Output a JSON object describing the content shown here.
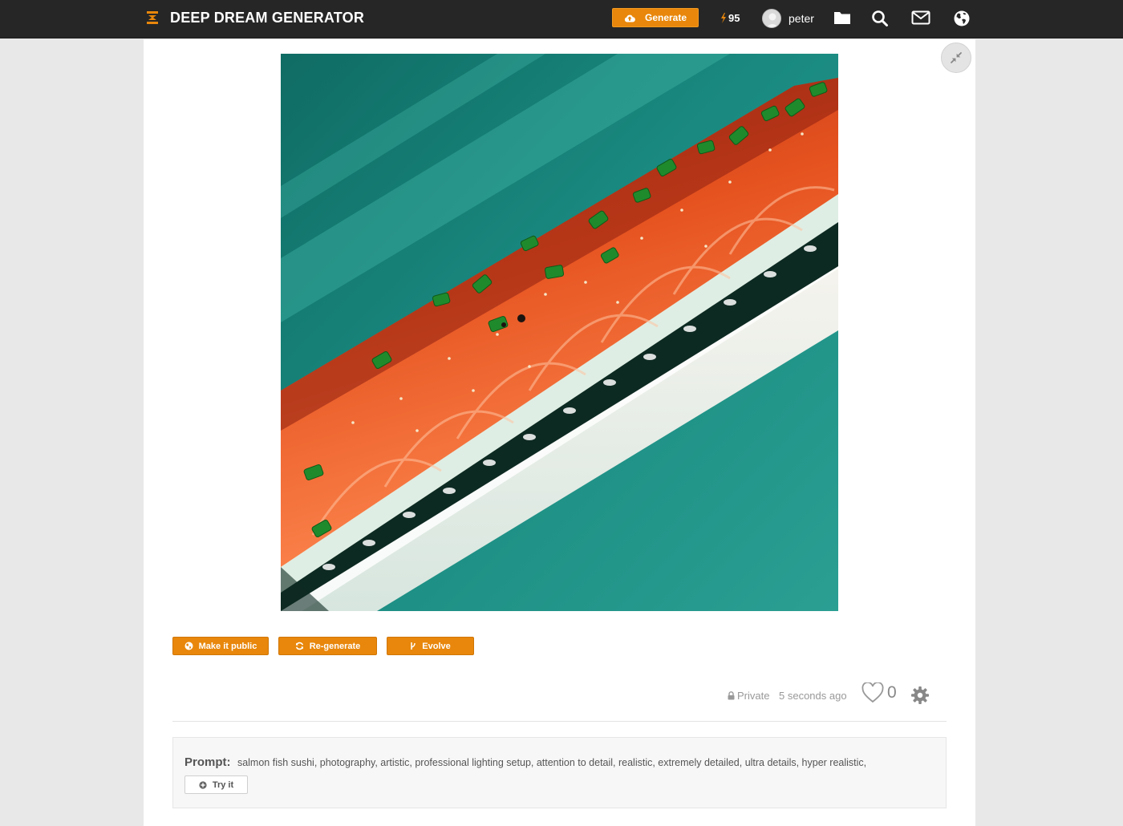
{
  "header": {
    "brand": "DEEP DREAM GENERATOR",
    "generate_label": "Generate",
    "energy": "95",
    "username": "peter",
    "icons": [
      "folder-icon",
      "search-icon",
      "mail-icon",
      "globe-icon"
    ]
  },
  "image": {
    "subject": "salmon fish sushi"
  },
  "actions": {
    "make_public": "Make it public",
    "regenerate": "Re-generate",
    "evolve": "Evolve"
  },
  "meta": {
    "visibility": "Private",
    "time": "5 seconds ago",
    "likes": "0"
  },
  "prompt": {
    "label": "Prompt:",
    "text": "salmon fish sushi, photography, artistic, professional lighting setup, attention to detail, realistic, extremely detailed, ultra details, hyper realistic,",
    "try_label": "Try it"
  },
  "colors": {
    "accent": "#e8870b",
    "navbar": "#262626",
    "page_bg": "#e8e8e8"
  }
}
